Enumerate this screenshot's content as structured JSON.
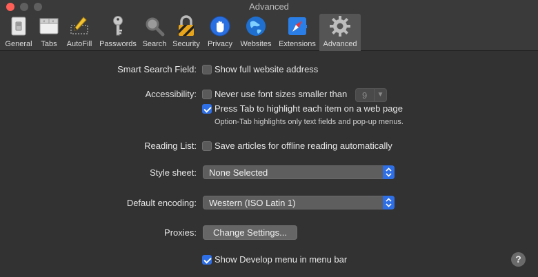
{
  "window": {
    "title": "Advanced"
  },
  "tabs": [
    {
      "label": "General",
      "icon": "general-switch-icon"
    },
    {
      "label": "Tabs",
      "icon": "tabs-window-icon"
    },
    {
      "label": "AutoFill",
      "icon": "autofill-pencil-icon"
    },
    {
      "label": "Passwords",
      "icon": "key-icon"
    },
    {
      "label": "Search",
      "icon": "magnifier-icon"
    },
    {
      "label": "Security",
      "icon": "lock-icon"
    },
    {
      "label": "Privacy",
      "icon": "hand-icon"
    },
    {
      "label": "Websites",
      "icon": "globe-icon"
    },
    {
      "label": "Extensions",
      "icon": "compass-icon"
    },
    {
      "label": "Advanced",
      "icon": "gear-icon",
      "selected": true
    }
  ],
  "settings": {
    "smart_search": {
      "label": "Smart Search Field:",
      "option": "Show full website address",
      "checked": false
    },
    "accessibility": {
      "label": "Accessibility:",
      "font_option": "Never use font sizes smaller than",
      "font_size": "9",
      "font_checked": false,
      "tab_option": "Press Tab to highlight each item on a web page",
      "tab_checked": true,
      "tab_note": "Option-Tab highlights only text fields and pop-up menus."
    },
    "reading_list": {
      "label": "Reading List:",
      "option": "Save articles for offline reading automatically",
      "checked": false
    },
    "style_sheet": {
      "label": "Style sheet:",
      "value": "None Selected"
    },
    "encoding": {
      "label": "Default encoding:",
      "value": "Western (ISO Latin 1)"
    },
    "proxies": {
      "label": "Proxies:",
      "button": "Change Settings..."
    },
    "develop": {
      "option": "Show Develop menu in menu bar",
      "checked": true
    }
  },
  "help": {
    "glyph": "?"
  },
  "colors": {
    "accent": "#2f6fe6",
    "background": "#323232",
    "toolbar": "#3a3a3a"
  }
}
